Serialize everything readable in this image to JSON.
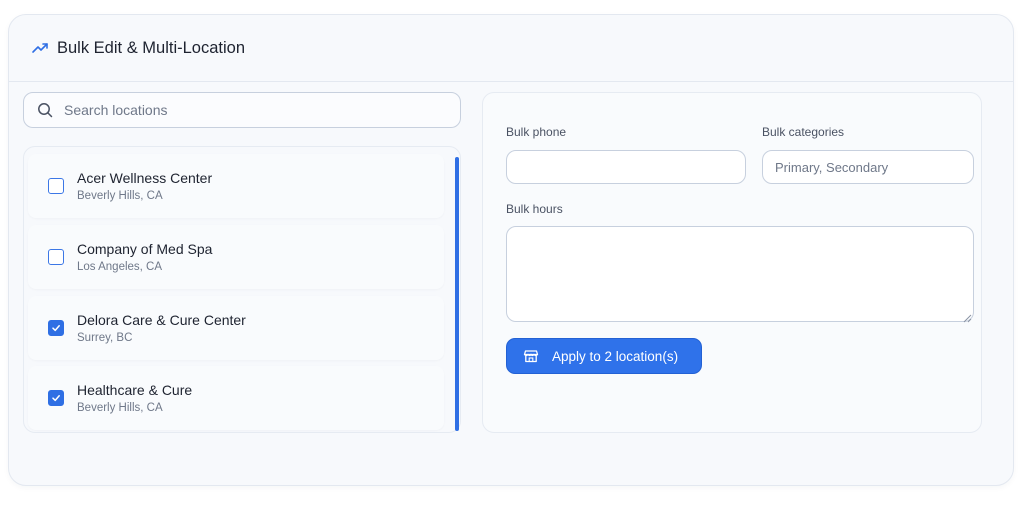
{
  "header": {
    "title": "Bulk Edit & Multi-Location",
    "icon": "trending-up-icon"
  },
  "search": {
    "placeholder": "Search locations",
    "value": ""
  },
  "locations": [
    {
      "name": "Acer Wellness Center",
      "city": "Beverly Hills, CA",
      "checked": false
    },
    {
      "name": "Company of Med Spa",
      "city": "Los Angeles, CA",
      "checked": false
    },
    {
      "name": "Delora Care & Cure Center",
      "city": "Surrey, BC",
      "checked": true
    },
    {
      "name": "Healthcare & Cure",
      "city": "Beverly Hills, CA",
      "checked": true
    }
  ],
  "form": {
    "phone_label": "Bulk phone",
    "phone_value": "",
    "categories_label": "Bulk categories",
    "categories_placeholder": "Primary, Secondary",
    "hours_label": "Bulk hours",
    "hours_value": "",
    "apply_label": "Apply to 2 location(s)"
  },
  "colors": {
    "accent": "#2f72ea",
    "checkbox": "#2f6fe4"
  }
}
